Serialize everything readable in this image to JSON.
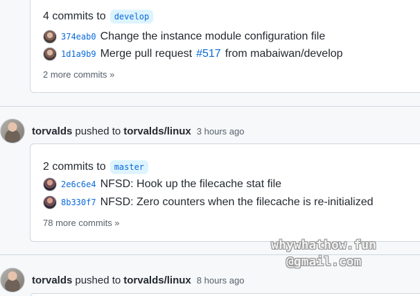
{
  "feed": {
    "top_card": {
      "summary_prefix": "4 commits to",
      "branch": "develop",
      "commits": [
        {
          "sha": "374eab0",
          "message": "Change the instance module configuration file"
        },
        {
          "sha": "1d1a9b9",
          "message_before": "Merge pull request ",
          "pr": "#517",
          "message_after": " from mabaiwan/develop"
        }
      ],
      "more": "2 more commits »"
    },
    "events": [
      {
        "actor": "torvalds",
        "verb": "pushed to",
        "repo": "torvalds/linux",
        "time": "3 hours ago",
        "card": {
          "summary_prefix": "2 commits to",
          "branch": "master",
          "commits": [
            {
              "sha": "2e6c6e4",
              "message": "NFSD: Hook up the filecache stat file"
            },
            {
              "sha": "8b330f7",
              "message": "NFSD: Zero counters when the filecache is re-initialized"
            }
          ],
          "more": "78 more commits »"
        }
      },
      {
        "actor": "torvalds",
        "verb": "pushed to",
        "repo": "torvalds/linux",
        "time": "8 hours ago"
      }
    ]
  },
  "watermark": {
    "line1": "whywhathow.fun",
    "line2": "@gmail.com"
  }
}
